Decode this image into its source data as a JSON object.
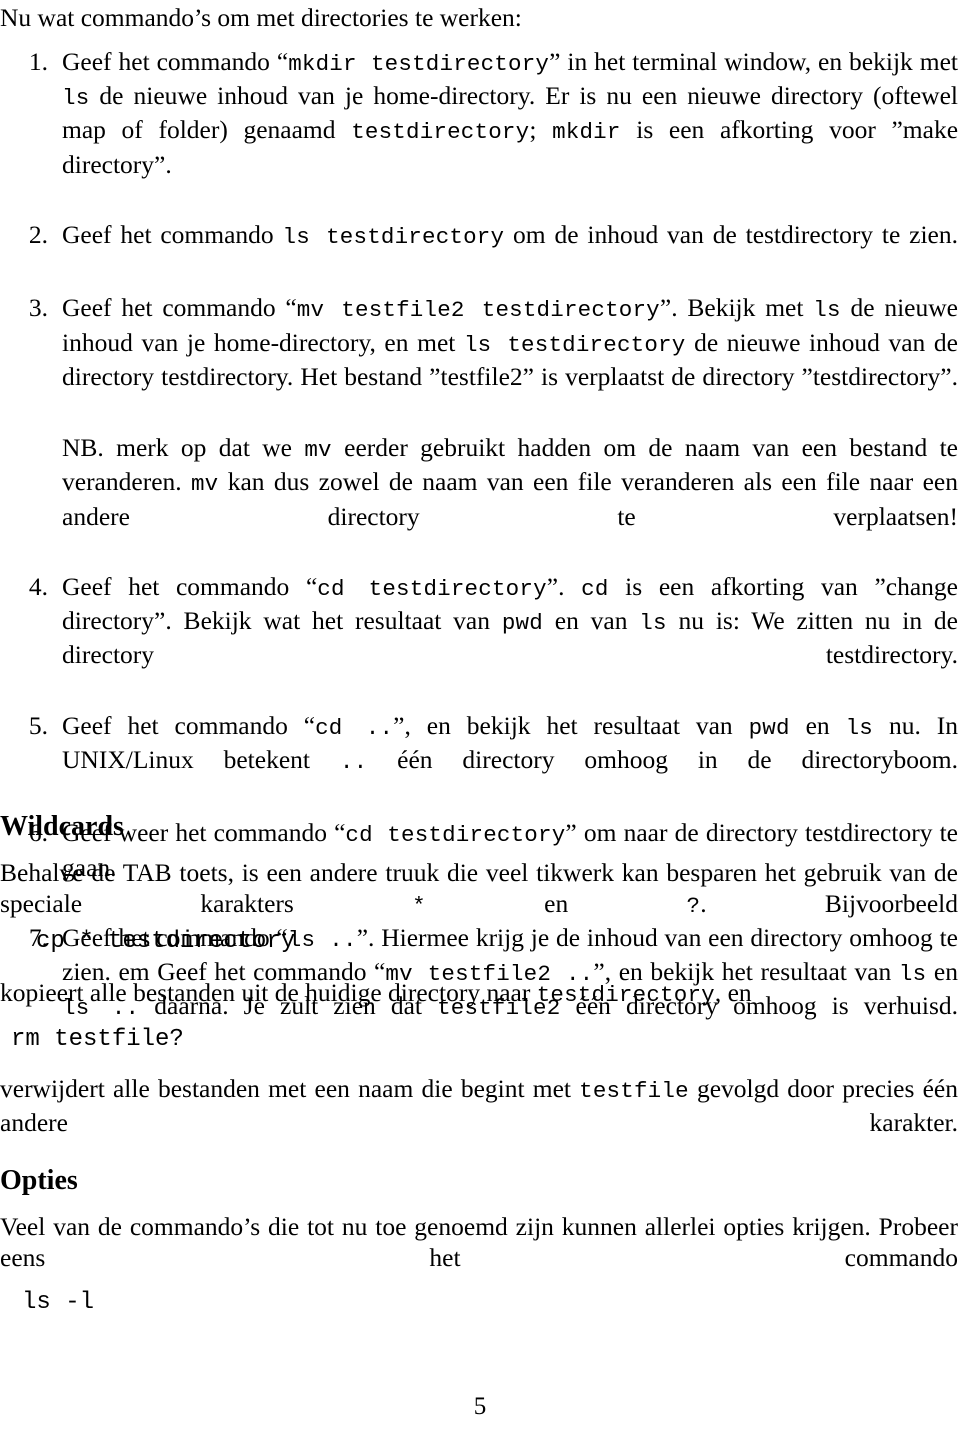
{
  "document": {
    "page_number": "5",
    "intro_line": "Nu wat commando’s om met directories te werken:"
  },
  "steps": [
    {
      "marker": "1.",
      "parts": [
        {
          "t": "text",
          "v": "Geef het commando “"
        },
        {
          "t": "code",
          "v": "mkdir testdirectory"
        },
        {
          "t": "text",
          "v": "” in het terminal window, en bekijk met "
        },
        {
          "t": "code",
          "v": "ls"
        },
        {
          "t": "text",
          "v": " de nieuwe inhoud van je home-directory. Er is nu een nieuwe directory (oftewel map of folder) genaamd "
        },
        {
          "t": "code",
          "v": "testdirectory"
        },
        {
          "t": "text",
          "v": "; "
        },
        {
          "t": "code",
          "v": "mkdir"
        },
        {
          "t": "text",
          "v": " is een afkorting voor ”make directory”."
        }
      ]
    },
    {
      "marker": "2.",
      "parts": [
        {
          "t": "text",
          "v": "Geef het commando "
        },
        {
          "t": "code",
          "v": "ls testdirectory"
        },
        {
          "t": "text",
          "v": " om de inhoud van de testdirectory te zien."
        }
      ]
    },
    {
      "marker": "3.",
      "parts": [
        {
          "t": "text",
          "v": "Geef het commando “"
        },
        {
          "t": "code",
          "v": "mv testfile2 testdirectory"
        },
        {
          "t": "text",
          "v": "”. Bekijk met "
        },
        {
          "t": "code",
          "v": "ls"
        },
        {
          "t": "text",
          "v": " de nieuwe inhoud van je home-directory, en met "
        },
        {
          "t": "code",
          "v": "ls testdirectory"
        },
        {
          "t": "text",
          "v": " de nieuwe inhoud van de directory testdirectory. Het bestand ”testfile2” is verplaatst de directory ”testdirectory”."
        }
      ],
      "parts2": [
        {
          "t": "text",
          "v": "NB. merk op dat we "
        },
        {
          "t": "code",
          "v": "mv"
        },
        {
          "t": "text",
          "v": " eerder gebruikt hadden om de naam van een bestand te veranderen. "
        },
        {
          "t": "code",
          "v": "mv"
        },
        {
          "t": "text",
          "v": " kan dus zowel de naam van een file veranderen als een file naar een andere directory te verplaatsen!"
        }
      ]
    },
    {
      "marker": "4.",
      "parts": [
        {
          "t": "text",
          "v": "Geef het commando “"
        },
        {
          "t": "code",
          "v": "cd testdirectory"
        },
        {
          "t": "text",
          "v": "”. "
        },
        {
          "t": "code",
          "v": "cd"
        },
        {
          "t": "text",
          "v": " is een afkorting van ”change directory”. Bekijk wat het resultaat van "
        },
        {
          "t": "code",
          "v": "pwd"
        },
        {
          "t": "text",
          "v": " en van "
        },
        {
          "t": "code",
          "v": "ls"
        },
        {
          "t": "text",
          "v": " nu is: We zitten nu in de directory testdirectory."
        }
      ]
    },
    {
      "marker": "5.",
      "parts": [
        {
          "t": "text",
          "v": "Geef het commando “"
        },
        {
          "t": "code",
          "v": "cd .."
        },
        {
          "t": "text",
          "v": "”, en bekijk het resultaat van "
        },
        {
          "t": "code",
          "v": "pwd"
        },
        {
          "t": "text",
          "v": " en "
        },
        {
          "t": "code",
          "v": "ls"
        },
        {
          "t": "text",
          "v": " nu. In UNIX/Linux betekent "
        },
        {
          "t": "code",
          "v": ".."
        },
        {
          "t": "text",
          "v": " één directory omhoog in de directoryboom."
        }
      ]
    },
    {
      "marker": "6.",
      "parts": [
        {
          "t": "text",
          "v": "Geef weer het commando “"
        },
        {
          "t": "code",
          "v": "cd testdirectory"
        },
        {
          "t": "text",
          "v": "” om naar de directory testdirectory te gaan."
        }
      ]
    },
    {
      "marker": "7.",
      "parts": [
        {
          "t": "text",
          "v": "Geef het commando “"
        },
        {
          "t": "code",
          "v": "ls .."
        },
        {
          "t": "text",
          "v": "”. Hiermee krijg je de inhoud van een directory omhoog te zien. em Geef het commando “"
        },
        {
          "t": "code",
          "v": "mv testfile2 .."
        },
        {
          "t": "text",
          "v": "”, en bekijk het resultaat van "
        },
        {
          "t": "code",
          "v": "ls"
        },
        {
          "t": "text",
          "v": " en "
        },
        {
          "t": "code",
          "v": "ls .."
        },
        {
          "t": "text",
          "v": " daarna. Je zult zien dat "
        },
        {
          "t": "code",
          "v": "testfile2"
        },
        {
          "t": "text",
          "v": " één directory omhoog is verhuisd."
        }
      ]
    }
  ],
  "sections": [
    {
      "heading": "Wildcards",
      "paragraph_1": [
        {
          "t": "text",
          "v": "Behalve de TAB toets, is een andere truuk die veel tikwerk kan besparen het gebruik van de speciale karakters "
        },
        {
          "t": "code",
          "v": "*"
        },
        {
          "t": "text",
          "v": " en "
        },
        {
          "t": "code",
          "v": "?"
        },
        {
          "t": "text",
          "v": ". Bijvoorbeeld"
        }
      ],
      "code_1": "cp * testdirectory",
      "paragraph_2": [
        {
          "t": "text",
          "v": "kopieert alle bestanden uit de huidige directory naar "
        },
        {
          "t": "code",
          "v": "testdirectory"
        },
        {
          "t": "text",
          "v": ", en"
        }
      ],
      "code_2": "rm testfile?",
      "paragraph_3": [
        {
          "t": "text",
          "v": "verwijdert alle bestanden met een naam die begint met "
        },
        {
          "t": "code",
          "v": "testfile"
        },
        {
          "t": "text",
          "v": " gevolgd door precies één andere karakter."
        }
      ]
    },
    {
      "heading": "Opties",
      "paragraph_1": [
        {
          "t": "text",
          "v": "Veel van de commando’s die tot nu toe genoemd zijn kunnen allerlei opties krijgen. Probeer eens het commando"
        }
      ],
      "code_1": "ls -l"
    }
  ]
}
